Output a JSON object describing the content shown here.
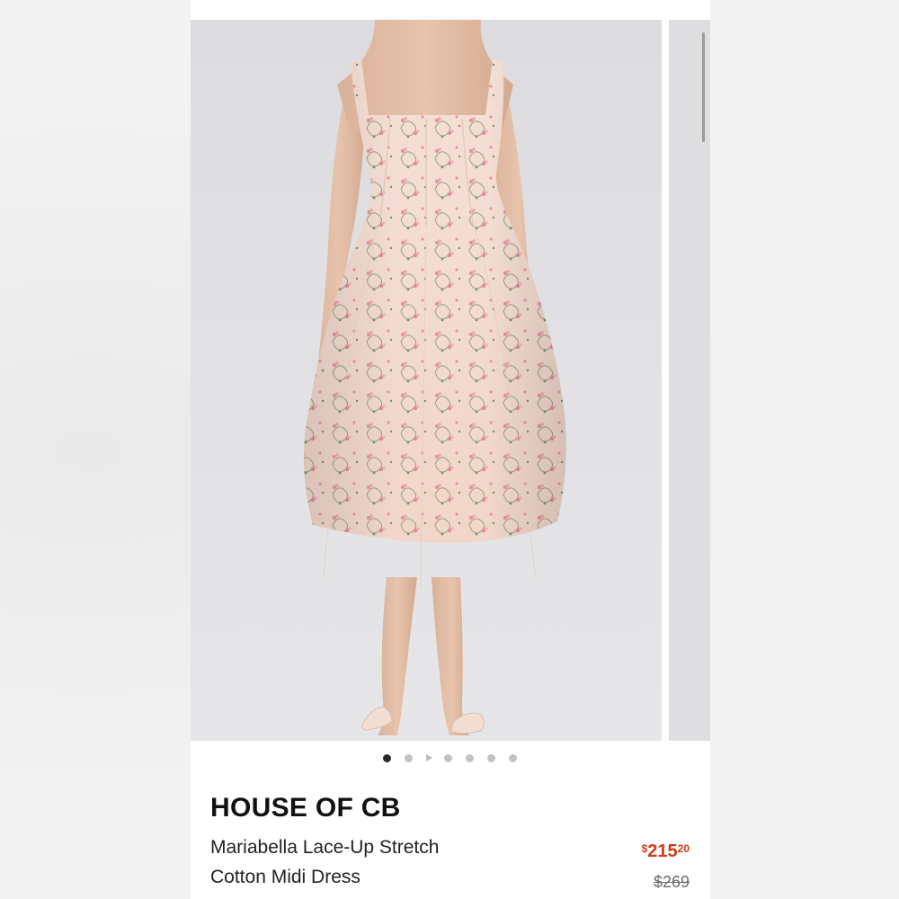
{
  "product": {
    "brand": "HOUSE OF CB",
    "name_line1": "Mariabella Lace-Up Stretch",
    "name_line2": "Cotton Midi Dress",
    "price": {
      "currency": "$",
      "dollars": "215",
      "cents": "20",
      "color": "#d03a1a"
    },
    "original_price": "$269"
  },
  "gallery": {
    "image_count": 7,
    "active_index": 0,
    "has_video": true,
    "photo_subject": "model wearing pink floral midi dress"
  },
  "colors": {
    "dress_base": "#f4dcd2",
    "floral_pink": "#e98c9c",
    "floral_green": "#7a8c6e",
    "price_red": "#d03a1a"
  }
}
